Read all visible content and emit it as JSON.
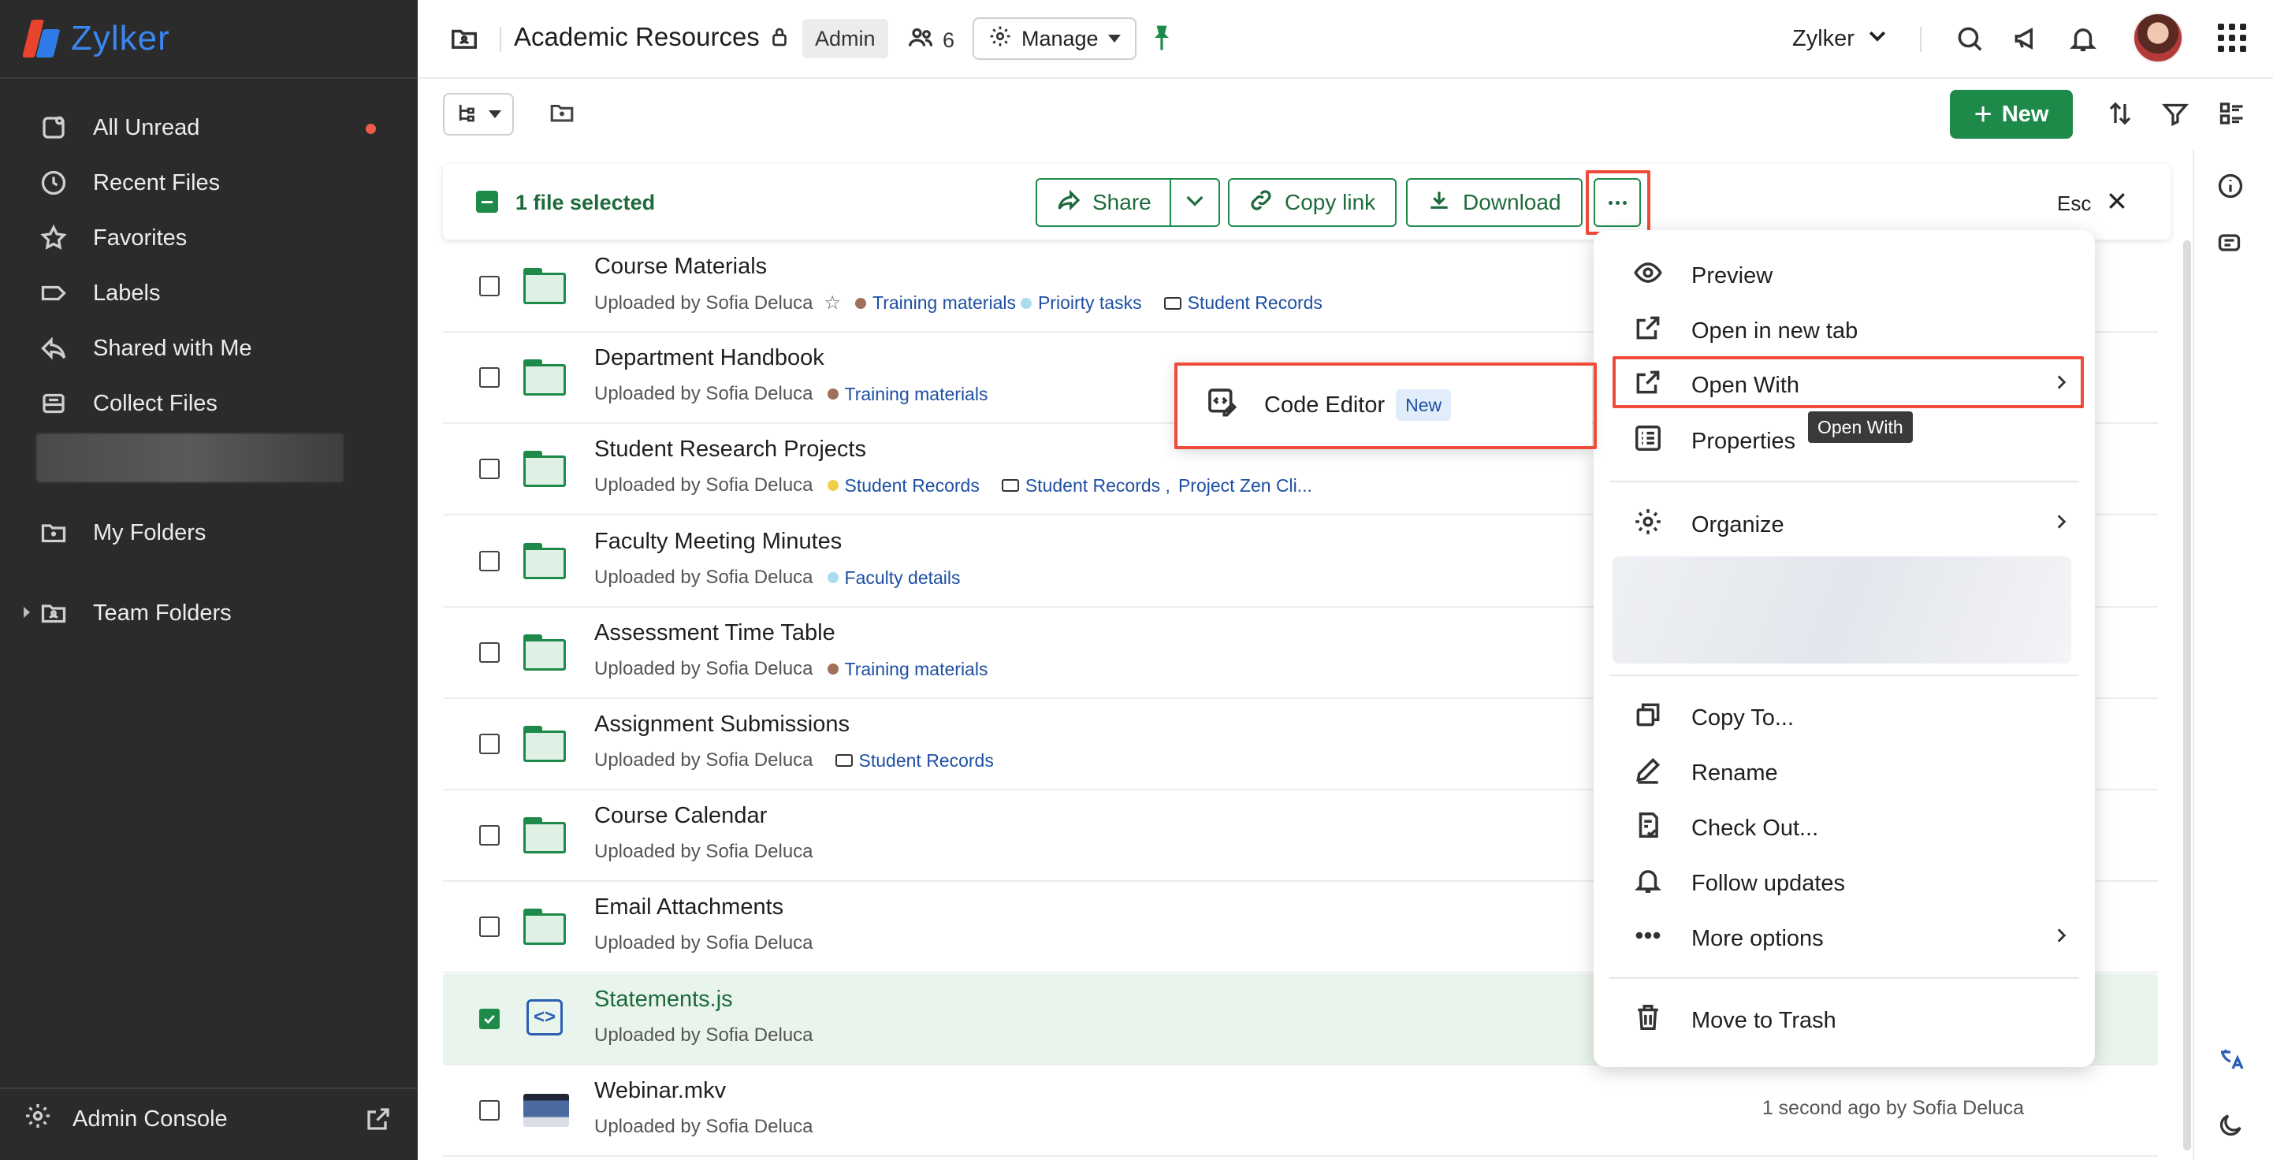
{
  "sidebar": {
    "brand": "Zylker",
    "items": [
      {
        "label": "All Unread",
        "icon": "unread-icon"
      },
      {
        "label": "Recent Files",
        "icon": "clock-icon"
      },
      {
        "label": "Favorites",
        "icon": "star-icon"
      },
      {
        "label": "Labels",
        "icon": "label-icon"
      },
      {
        "label": "Shared with Me",
        "icon": "shared-icon"
      },
      {
        "label": "Collect Files",
        "icon": "inbox-icon"
      },
      {
        "label": "My Folders",
        "icon": "folder-icon"
      },
      {
        "label": "Team Folders",
        "icon": "team-folder-icon"
      }
    ],
    "admin_console": "Admin Console"
  },
  "header": {
    "title": "Academic Resources",
    "role_badge": "Admin",
    "member_count": "6",
    "manage_label": "Manage",
    "org_name": "Zylker"
  },
  "toolbar": {
    "new_label": "New"
  },
  "selection_bar": {
    "text": "1 file selected",
    "share": "Share",
    "copy_link": "Copy link",
    "download": "Download",
    "esc": "Esc"
  },
  "files": [
    {
      "name": "Course Materials",
      "meta": "Uploaded by Sofia Deluca",
      "type": "folder",
      "starred": true,
      "tags": [
        {
          "label": "Training materials",
          "color": "#a0705a"
        },
        {
          "label": "Prioirty tasks",
          "color": "#a8ddee"
        }
      ],
      "labels": [
        "Student Records"
      ]
    },
    {
      "name": "Department Handbook",
      "meta": "Uploaded by Sofia Deluca",
      "type": "folder",
      "tags": [
        {
          "label": "Training materials",
          "color": "#a0705a"
        }
      ],
      "labels": []
    },
    {
      "name": "Student Research Projects",
      "meta": "Uploaded by Sofia Deluca",
      "type": "folder",
      "tags": [
        {
          "label": "Student Records",
          "color": "#f2cf4a"
        }
      ],
      "labels": [
        "Student Records ,",
        "Project Zen Cli..."
      ]
    },
    {
      "name": "Faculty Meeting Minutes",
      "meta": "Uploaded by Sofia Deluca",
      "type": "folder",
      "tags": [
        {
          "label": "Faculty details",
          "color": "#a8ddee"
        }
      ],
      "labels": []
    },
    {
      "name": "Assessment Time Table",
      "meta": "Uploaded by Sofia Deluca",
      "type": "folder",
      "tags": [
        {
          "label": "Training materials",
          "color": "#a0705a"
        }
      ],
      "labels": []
    },
    {
      "name": "Assignment Submissions",
      "meta": "Uploaded by Sofia Deluca",
      "type": "folder",
      "tags": [],
      "labels": [
        "Student Records"
      ]
    },
    {
      "name": "Course Calendar",
      "meta": "Uploaded by Sofia Deluca",
      "type": "folder",
      "tags": [],
      "labels": []
    },
    {
      "name": "Email Attachments",
      "meta": "Uploaded by Sofia Deluca",
      "type": "folder",
      "tags": [],
      "labels": []
    },
    {
      "name": "Statements.js",
      "meta": "Uploaded by Sofia Deluca",
      "type": "code",
      "selected": true,
      "tags": [],
      "labels": []
    },
    {
      "name": "Webinar.mkv",
      "meta": "Uploaded by Sofia Deluca",
      "type": "video",
      "tags": [],
      "labels": [],
      "time": "1 second ago by Sofia Deluca"
    }
  ],
  "context_menu": {
    "items": [
      {
        "label": "Preview",
        "icon": "eye-icon"
      },
      {
        "label": "Open in new tab",
        "icon": "external-link-icon"
      },
      {
        "label": "Open With",
        "icon": "open-with-icon",
        "submenu": true
      },
      {
        "label": "Properties",
        "icon": "properties-icon"
      },
      {
        "label": "Organize",
        "icon": "gear-icon",
        "submenu": true
      },
      {
        "label": "Copy To...",
        "icon": "copy-icon"
      },
      {
        "label": "Rename",
        "icon": "pencil-icon"
      },
      {
        "label": "Check Out...",
        "icon": "checkout-icon"
      },
      {
        "label": "Follow updates",
        "icon": "bell-icon"
      },
      {
        "label": "More options",
        "icon": "more-icon",
        "submenu": true
      },
      {
        "label": "Move to Trash",
        "icon": "trash-icon"
      }
    ],
    "tooltip": "Open With"
  },
  "submenu": {
    "item_label": "Code Editor",
    "badge": "New"
  },
  "colors": {
    "accent": "#1d8a4a",
    "highlight": "#ef4b3b",
    "sidebar_bg": "#2b2b2b"
  }
}
